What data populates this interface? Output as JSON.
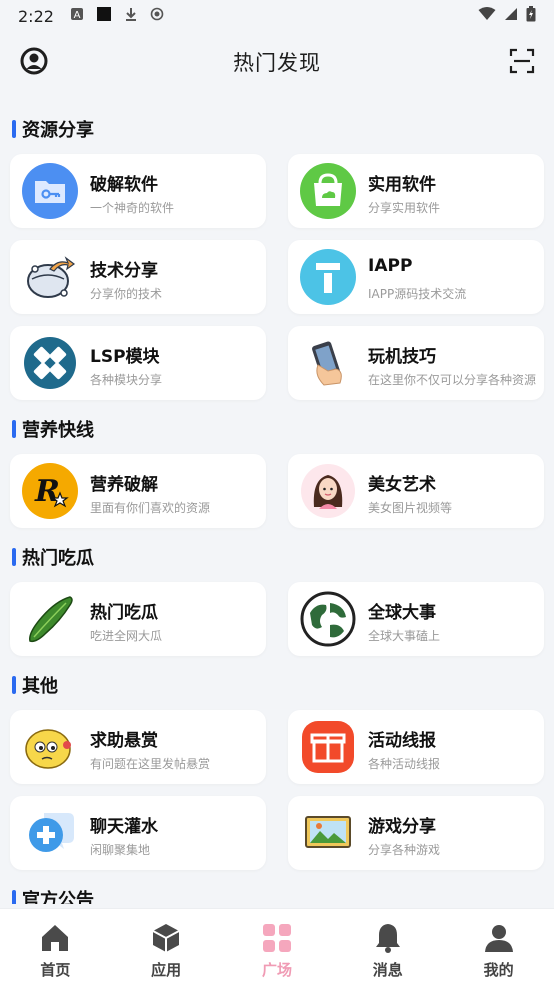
{
  "status_bar": {
    "time": "2:22"
  },
  "header": {
    "title": "热门发现"
  },
  "sections": [
    {
      "title": "资源分享",
      "items": [
        {
          "name": "破解软件",
          "desc": "一个神奇的软件",
          "icon": "folder-key-icon"
        },
        {
          "name": "实用软件",
          "desc": "分享实用软件",
          "icon": "shopping-bag-icon"
        },
        {
          "name": "技术分享",
          "desc": "分享你的技术",
          "icon": "globe-share-icon"
        },
        {
          "name": "IAPP",
          "desc": "IAPP源码技术交流",
          "icon": "iapp-icon"
        },
        {
          "name": "LSP模块",
          "desc": "各种模块分享",
          "icon": "lsposed-icon"
        },
        {
          "name": "玩机技巧",
          "desc": "在这里你不仅可以分享各种资源",
          "icon": "phone-hand-icon"
        }
      ]
    },
    {
      "title": "营养快线",
      "items": [
        {
          "name": "营养破解",
          "desc": "里面有你们喜欢的资源",
          "icon": "rockstar-icon"
        },
        {
          "name": "美女艺术",
          "desc": "美女图片视频等",
          "icon": "girl-avatar-icon"
        }
      ]
    },
    {
      "title": "热门吃瓜",
      "items": [
        {
          "name": "热门吃瓜",
          "desc": "吃进全网大瓜",
          "icon": "cucumber-icon"
        },
        {
          "name": "全球大事",
          "desc": "全球大事磕上",
          "icon": "earth-icon"
        }
      ]
    },
    {
      "title": "其他",
      "items": [
        {
          "name": "求助悬赏",
          "desc": "有问题在这里发帖悬赏",
          "icon": "emoji-face-icon"
        },
        {
          "name": "活动线报",
          "desc": "各种活动线报",
          "icon": "gift-icon"
        },
        {
          "name": "聊天灌水",
          "desc": "闲聊聚集地",
          "icon": "chat-plus-icon"
        },
        {
          "name": "游戏分享",
          "desc": "分享各种游戏",
          "icon": "game-picture-icon"
        }
      ]
    },
    {
      "title": "官方公告",
      "items": []
    }
  ],
  "bottom_nav": [
    {
      "label": "首页",
      "icon": "home-icon",
      "active": false
    },
    {
      "label": "应用",
      "icon": "cube-icon",
      "active": false
    },
    {
      "label": "广场",
      "icon": "grid-icon",
      "active": true
    },
    {
      "label": "消息",
      "icon": "bell-icon",
      "active": false
    },
    {
      "label": "我的",
      "icon": "person-icon",
      "active": false
    }
  ],
  "colors": {
    "accent_bar": "#2a6af0",
    "nav_active": "#f09bb4",
    "background": "#f3f5f8"
  }
}
